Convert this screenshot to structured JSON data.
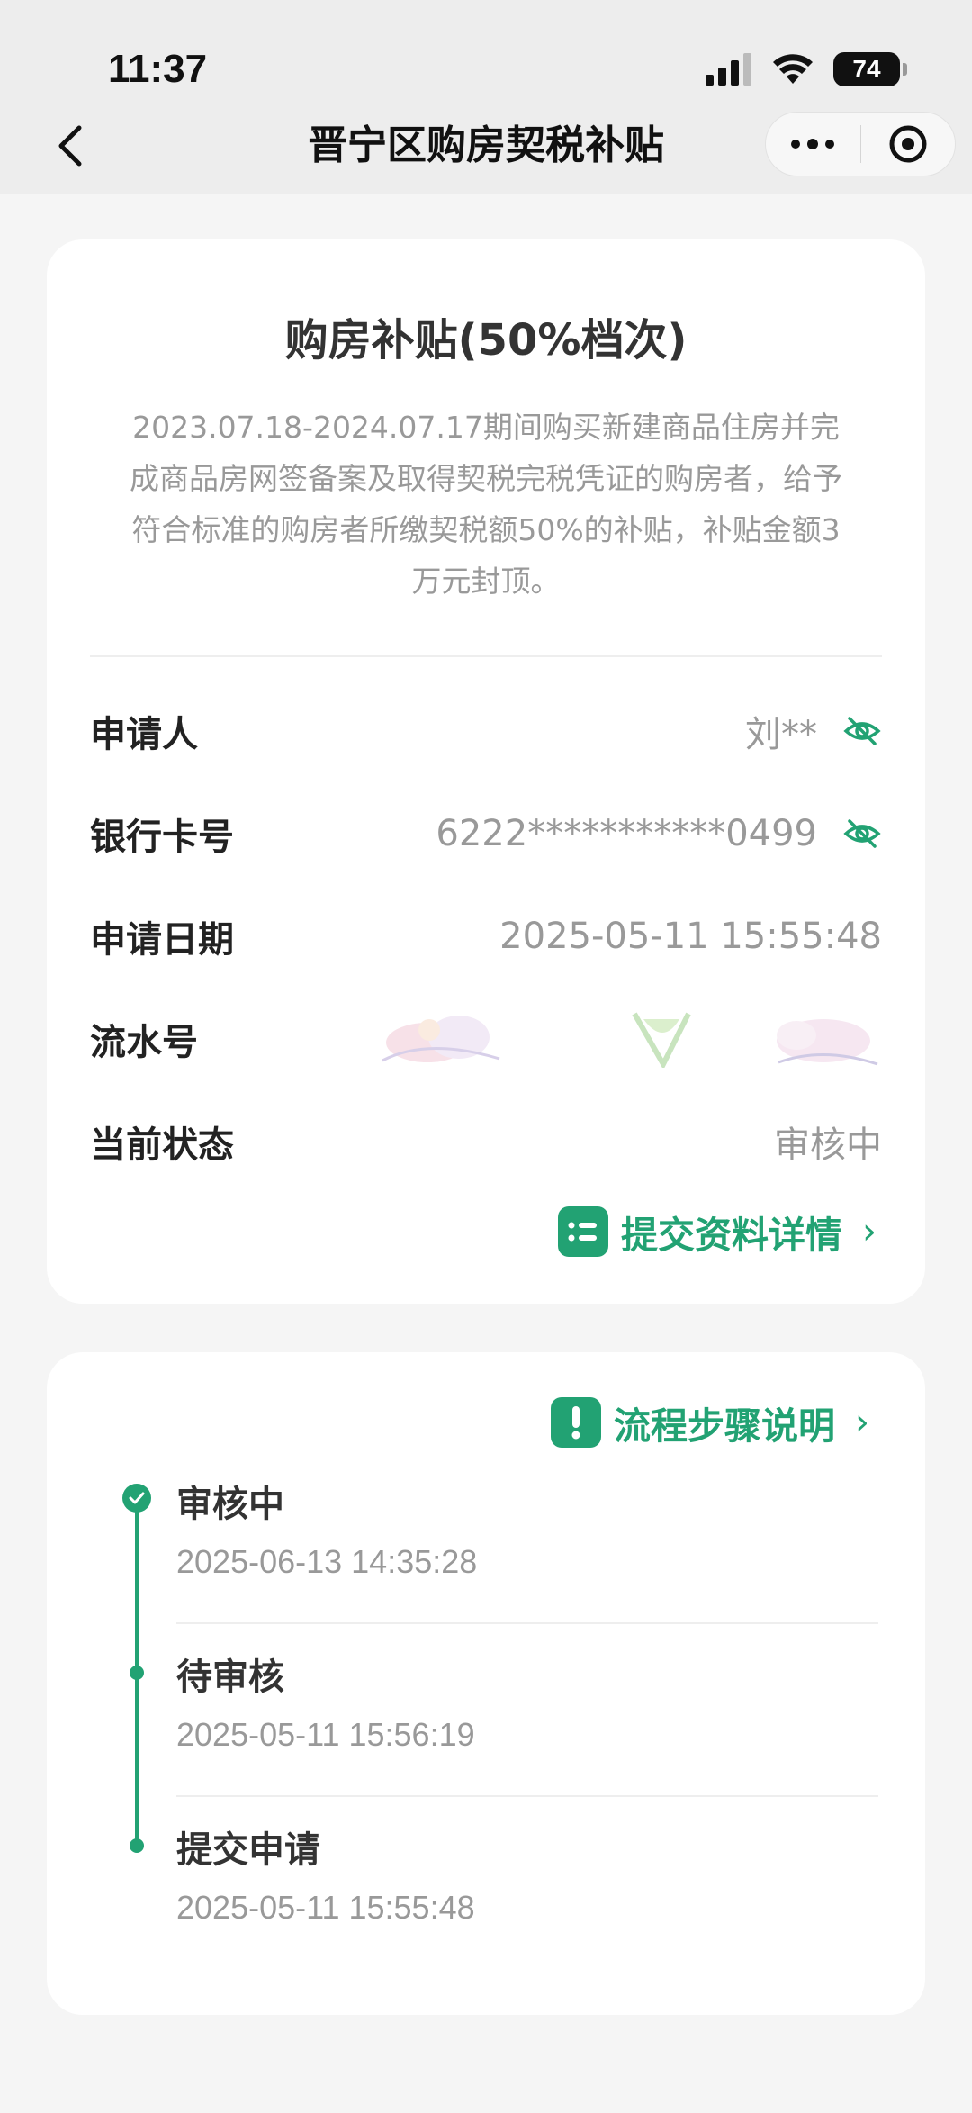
{
  "status_bar": {
    "time": "11:37",
    "battery": "74"
  },
  "nav": {
    "title": "晋宁区购房契税补贴"
  },
  "summary": {
    "title": "购房补贴(50%档次)",
    "description": "2023.07.18-2024.07.17期间购买新建商品住房并完成商品房网签备案及取得契税完税凭证的购房者，给予符合标准的购房者所缴契税额50%的补贴，补贴金额3万元封顶。"
  },
  "fields": {
    "applicant_label": "申请人",
    "applicant_value": "刘**",
    "bank_label": "银行卡号",
    "bank_value": "6222***********0499",
    "date_label": "申请日期",
    "date_value": "2025-05-11 15:55:48",
    "serial_label": "流水号",
    "status_label": "当前状态",
    "status_value": "审核中"
  },
  "actions": {
    "details_link": "提交资料详情",
    "process_link": "流程步骤说明"
  },
  "timeline": [
    {
      "title": "审核中",
      "time": "2025-06-13 14:35:28"
    },
    {
      "title": "待审核",
      "time": "2025-05-11 15:56:19"
    },
    {
      "title": "提交申请",
      "time": "2025-05-11 15:55:48"
    }
  ],
  "colors": {
    "accent": "#22a273",
    "muted_text": "#999999",
    "page_bg": "#f5f5f5"
  }
}
